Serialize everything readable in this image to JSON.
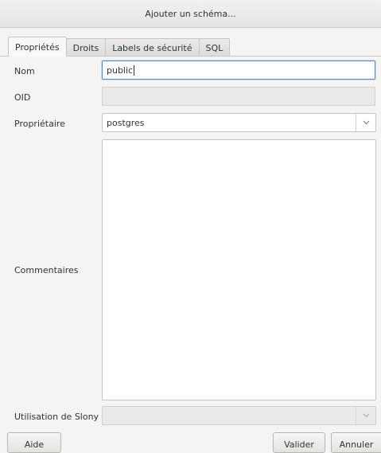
{
  "window": {
    "title": "Ajouter un schéma..."
  },
  "tabs": [
    {
      "label": "Propriétés",
      "active": true
    },
    {
      "label": "Droits",
      "active": false
    },
    {
      "label": "Labels de sécurité",
      "active": false
    },
    {
      "label": "SQL",
      "active": false
    }
  ],
  "form": {
    "name": {
      "label": "Nom",
      "value": "public"
    },
    "oid": {
      "label": "OID",
      "value": ""
    },
    "owner": {
      "label": "Propriétaire",
      "value": "postgres"
    },
    "comments": {
      "label": "Commentaires",
      "value": ""
    },
    "slony": {
      "label": "Utilisation de Slony",
      "value": ""
    }
  },
  "buttons": {
    "help": "Aide",
    "ok": "Valider",
    "cancel": "Annuler"
  },
  "colors": {
    "focus_border": "#4a90d9",
    "window_bg": "#f5f4f3"
  },
  "icons": {
    "combo_arrow": "chevron-down-icon"
  }
}
